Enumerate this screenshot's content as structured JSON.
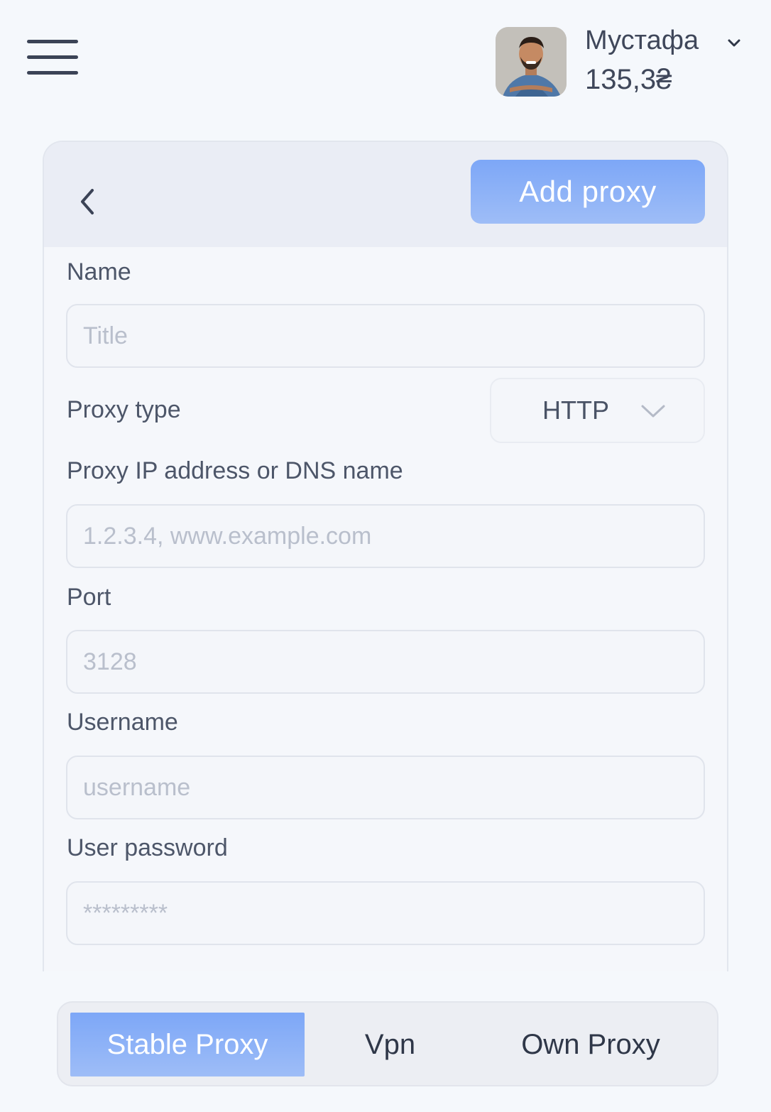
{
  "header": {
    "user_name": "Мустафа",
    "balance": "135,3₴"
  },
  "form": {
    "back_icon": "chevron-left-icon",
    "add_button": "Add proxy",
    "name_label": "Name",
    "name_placeholder": "Title",
    "proxy_type_label": "Proxy type",
    "proxy_type_value": "HTTP",
    "address_label": "Proxy IP address or DNS name",
    "address_placeholder": "1.2.3.4, www.example.com",
    "port_label": "Port",
    "port_placeholder": "3128",
    "username_label": "Username",
    "username_placeholder": "username",
    "password_label": "User password",
    "password_placeholder": "*********"
  },
  "tabs": [
    {
      "label": "Stable Proxy",
      "active": true
    },
    {
      "label": "Vpn",
      "active": false
    },
    {
      "label": "Own Proxy",
      "active": false
    }
  ],
  "colors": {
    "accent": "#82abf7",
    "background": "#f5f8fc",
    "text": "#434d63"
  }
}
